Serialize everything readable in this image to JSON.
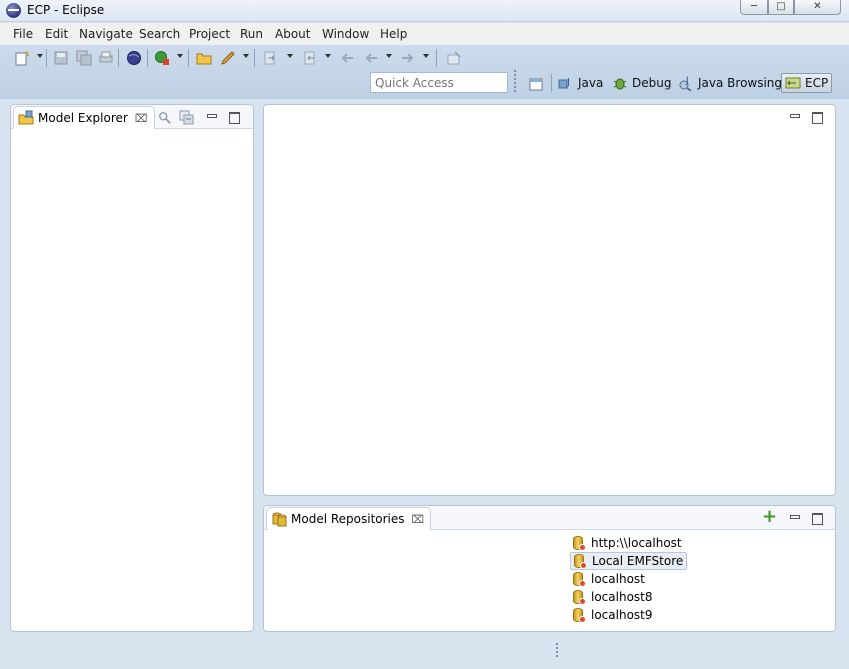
{
  "window": {
    "title": "ECP - Eclipse",
    "minimize_label": "─",
    "maximize_label": "□",
    "close_label": "✕"
  },
  "menu": [
    "File",
    "Edit",
    "Navigate",
    "Search",
    "Project",
    "Run",
    "About",
    "Window",
    "Help"
  ],
  "toolbar": {
    "quick_access_placeholder": "Quick Access"
  },
  "perspectives": [
    {
      "label": "Java",
      "icon": "java-perspective-icon"
    },
    {
      "label": "Debug",
      "icon": "debug-bug-icon"
    },
    {
      "label": "Java Browsing",
      "icon": "java-browsing-icon"
    },
    {
      "label": "ECP",
      "icon": "ecp-perspective-icon",
      "active": true
    }
  ],
  "model_explorer": {
    "tab_label": "Model Explorer",
    "close_glyph": "⌧"
  },
  "model_repositories": {
    "tab_label": "Model Repositories",
    "close_glyph": "⌧",
    "add_glyph": "+",
    "items": [
      "http:\\\\localhost",
      "Local EMFStore",
      "localhost",
      "localhost8",
      "localhost9"
    ],
    "selected_index": 1
  },
  "colors": {
    "toolbar_bg": "#c5d6e9",
    "panel_border": "#b6c5d6",
    "add_green": "#3a9b2a"
  }
}
